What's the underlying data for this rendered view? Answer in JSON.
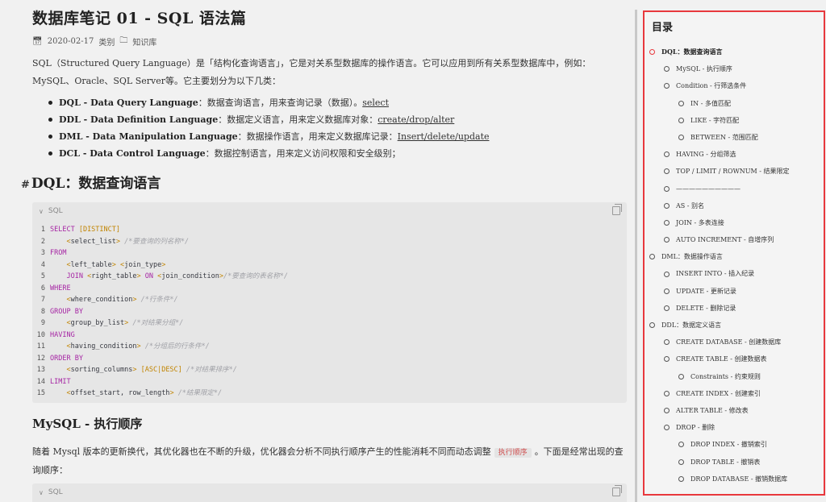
{
  "article": {
    "title": "数据库笔记 01 - SQL 语法篇",
    "date": "2020-02-17",
    "category_label": "类别",
    "category": "知识库",
    "intro": "SQL（Structured Query Language）是「结构化查询语言」，它是对关系型数据库的操作语言。它可以应用到所有关系型数据库中，例如：MySQL、Oracle、SQL Server等。它主要划分为以下几类：",
    "bullets": [
      {
        "name": "DQL - Data Query Language",
        "desc": "：数据查询语言，用来查询记录（数据）。",
        "link": "select"
      },
      {
        "name": "DDL - Data Definition Language",
        "desc": "：数据定义语言，用来定义数据库对象：",
        "link": "create/drop/alter"
      },
      {
        "name": "DML - Data Manipulation Language",
        "desc": "：数据操作语言，用来定义数据库记录：",
        "link": "Insert/delete/update"
      },
      {
        "name": "DCL - Data Control Language",
        "desc": "：数据控制语言，用来定义访问权限和安全级别；",
        "link": ""
      }
    ],
    "h2": "DQL：数据查询语言",
    "h2_hash": "#",
    "code_lang": "SQL",
    "code_lines": [
      {
        "n": "1",
        "parts": [
          [
            "kw",
            "SELECT "
          ],
          [
            "br",
            "[DISTINCT]"
          ]
        ]
      },
      {
        "n": "2",
        "parts": [
          [
            "tx",
            "    "
          ],
          [
            "br",
            "<"
          ],
          [
            "tx",
            "select_list"
          ],
          [
            "br",
            "> "
          ],
          [
            "cm",
            "/*要查询的列名称*/"
          ]
        ]
      },
      {
        "n": "3",
        "parts": [
          [
            "kw",
            "FROM"
          ]
        ]
      },
      {
        "n": "4",
        "parts": [
          [
            "tx",
            "    "
          ],
          [
            "br",
            "<"
          ],
          [
            "tx",
            "left_table"
          ],
          [
            "br",
            "> <"
          ],
          [
            "tx",
            "join_type"
          ],
          [
            "br",
            ">"
          ]
        ]
      },
      {
        "n": "5",
        "parts": [
          [
            "tx",
            "    "
          ],
          [
            "kw",
            "JOIN "
          ],
          [
            "br",
            "<"
          ],
          [
            "tx",
            "right_table"
          ],
          [
            "br",
            "> "
          ],
          [
            "kw",
            "ON "
          ],
          [
            "br",
            "<"
          ],
          [
            "tx",
            "join_condition"
          ],
          [
            "br",
            ">"
          ],
          [
            "cm",
            "/*要查询的表名称*/"
          ]
        ]
      },
      {
        "n": "6",
        "parts": [
          [
            "kw",
            "WHERE"
          ]
        ]
      },
      {
        "n": "7",
        "parts": [
          [
            "tx",
            "    "
          ],
          [
            "br",
            "<"
          ],
          [
            "tx",
            "where_condition"
          ],
          [
            "br",
            "> "
          ],
          [
            "cm",
            "/*行条件*/"
          ]
        ]
      },
      {
        "n": "8",
        "parts": [
          [
            "kw",
            "GROUP BY"
          ]
        ]
      },
      {
        "n": "9",
        "parts": [
          [
            "tx",
            "    "
          ],
          [
            "br",
            "<"
          ],
          [
            "tx",
            "group_by_list"
          ],
          [
            "br",
            "> "
          ],
          [
            "cm",
            "/*对结果分组*/"
          ]
        ]
      },
      {
        "n": "10",
        "parts": [
          [
            "kw",
            "HAVING"
          ]
        ]
      },
      {
        "n": "11",
        "parts": [
          [
            "tx",
            "    "
          ],
          [
            "br",
            "<"
          ],
          [
            "tx",
            "having_condition"
          ],
          [
            "br",
            "> "
          ],
          [
            "cm",
            "/*分组后的行条件*/"
          ]
        ]
      },
      {
        "n": "12",
        "parts": [
          [
            "kw",
            "ORDER BY"
          ]
        ]
      },
      {
        "n": "13",
        "parts": [
          [
            "tx",
            "    "
          ],
          [
            "br",
            "<"
          ],
          [
            "tx",
            "sorting_columns"
          ],
          [
            "br",
            "> [ASC|DESC] "
          ],
          [
            "cm",
            "/*对结果排序*/"
          ]
        ]
      },
      {
        "n": "14",
        "parts": [
          [
            "kw",
            "LIMIT"
          ]
        ]
      },
      {
        "n": "15",
        "parts": [
          [
            "tx",
            "    "
          ],
          [
            "br",
            "<"
          ],
          [
            "tx",
            "offset_start, row_length"
          ],
          [
            "br",
            "> "
          ],
          [
            "cm",
            "/*结果限定*/"
          ]
        ]
      }
    ],
    "h3": "MySQL - 执行顺序",
    "para2_before": "随着 Mysql 版本的更新换代，其优化器也在不断的升级，优化器会分析不同执行顺序产生的性能消耗不同而动态调整",
    "para2_code": "执行顺序",
    "para2_after": "。下面是经常出现的查询顺序：",
    "code2_lang": "SQL"
  },
  "toc": {
    "title": "目录",
    "items": [
      {
        "level": 1,
        "label": "DQL：数据查询语言",
        "active": true
      },
      {
        "level": 2,
        "label": "MySQL - 执行顺序"
      },
      {
        "level": 2,
        "label": "Condition - 行筛选条件"
      },
      {
        "level": 3,
        "label": "IN - 多值匹配"
      },
      {
        "level": 3,
        "label": "LIKE - 字符匹配"
      },
      {
        "level": 3,
        "label": "BETWEEN - 范围匹配"
      },
      {
        "level": 2,
        "label": "HAVING - 分组筛选"
      },
      {
        "level": 2,
        "label": "TOP / LIMIT / ROWNUM - 结果限定"
      },
      {
        "level": 2,
        "label": "——————————"
      },
      {
        "level": 2,
        "label": "AS - 别名"
      },
      {
        "level": 2,
        "label": "JOIN - 多表连接"
      },
      {
        "level": 2,
        "label": "AUTO INCREMENT - 自增序列"
      },
      {
        "level": 1,
        "label": "DML：数据操作语言"
      },
      {
        "level": 2,
        "label": "INSERT INTO - 插入纪录"
      },
      {
        "level": 2,
        "label": "UPDATE - 更新记录"
      },
      {
        "level": 2,
        "label": "DELETE - 删除记录"
      },
      {
        "level": 1,
        "label": "DDL：数据定义语言"
      },
      {
        "level": 2,
        "label": "CREATE DATABASE - 创建数据库"
      },
      {
        "level": 2,
        "label": "CREATE TABLE - 创建数据表"
      },
      {
        "level": 3,
        "label": "Constraints - 约束规则"
      },
      {
        "level": 2,
        "label": "CREATE INDEX - 创建索引"
      },
      {
        "level": 2,
        "label": "ALTER TABLE - 修改表"
      },
      {
        "level": 2,
        "label": "DROP - 删除"
      },
      {
        "level": 3,
        "label": "DROP INDEX - 撤销索引"
      },
      {
        "level": 3,
        "label": "DROP TABLE - 撤销表"
      },
      {
        "level": 3,
        "label": "DROP DATABASE - 撤销数据库"
      }
    ]
  }
}
